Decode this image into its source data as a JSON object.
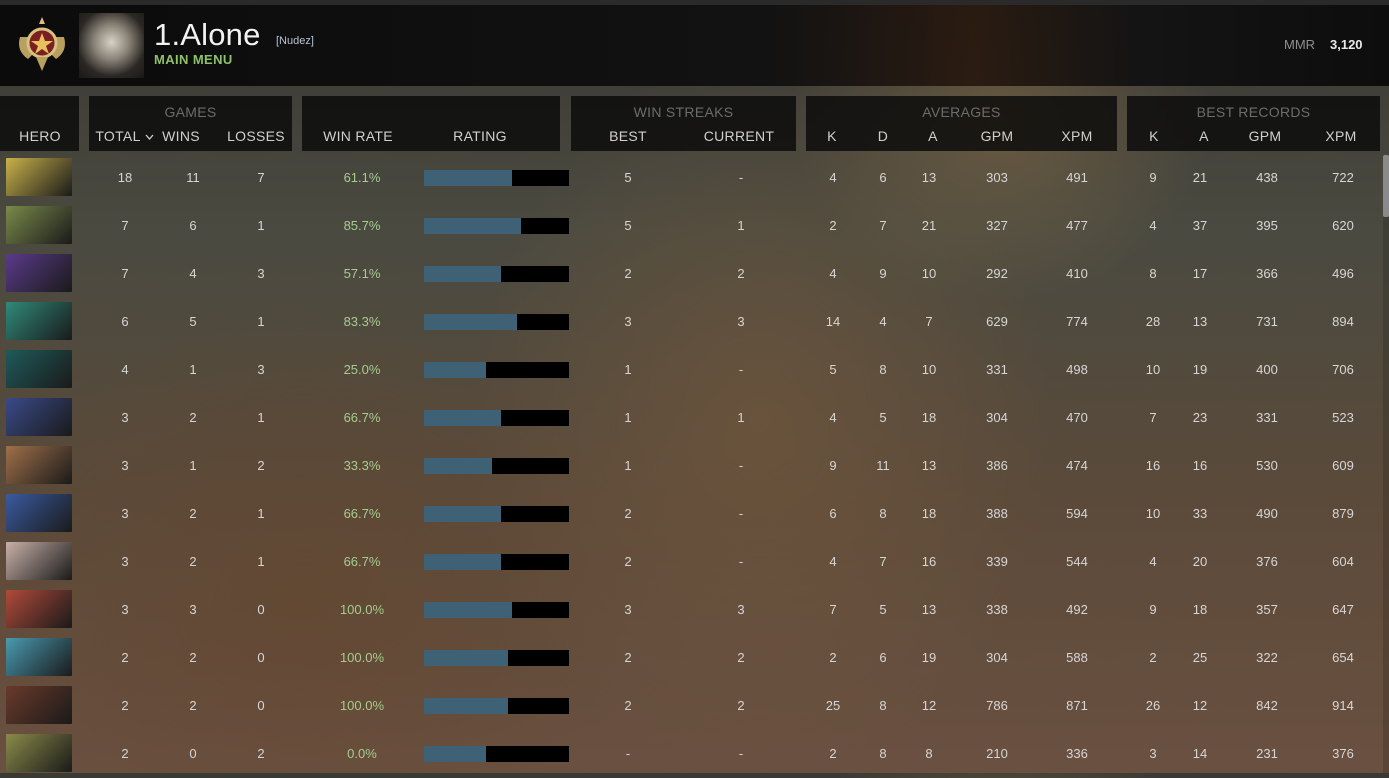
{
  "header": {
    "player_name": "1.Alone",
    "player_tag": "[Nudez]",
    "main_menu": "MAIN MENU",
    "mmr_label": "MMR",
    "mmr_value": "3,120"
  },
  "columns": {
    "hero": "HERO",
    "games_group": "GAMES",
    "total": "TOTAL",
    "wins": "WINS",
    "losses": "LOSSES",
    "win_rate": "WIN RATE",
    "rating": "RATING",
    "streaks_group": "WIN STREAKS",
    "best": "BEST",
    "current": "CURRENT",
    "averages_group": "AVERAGES",
    "best_records_group": "BEST RECORDS",
    "k": "K",
    "d": "D",
    "a": "A",
    "gpm": "GPM",
    "xpm": "XPM",
    "sort_indicator": "chevron-down-icon"
  },
  "colors": {
    "accent_green": "#8fc06a",
    "winrate_green": "#a5cc8f",
    "rating_bar": "#3f6175"
  },
  "rows": [
    {
      "hero_color": "#c9b24a",
      "total": "18",
      "wins": "11",
      "losses": "7",
      "winrate": "61.1%",
      "rating": 0.61,
      "best_streak": "5",
      "current_streak": "-",
      "avg_k": "4",
      "avg_d": "6",
      "avg_a": "13",
      "avg_gpm": "303",
      "avg_xpm": "491",
      "best_k": "9",
      "best_a": "21",
      "best_gpm": "438",
      "best_xpm": "722"
    },
    {
      "hero_color": "#7a8a4a",
      "total": "7",
      "wins": "6",
      "losses": "1",
      "winrate": "85.7%",
      "rating": 0.67,
      "best_streak": "5",
      "current_streak": "1",
      "avg_k": "2",
      "avg_d": "7",
      "avg_a": "21",
      "avg_gpm": "327",
      "avg_xpm": "477",
      "best_k": "4",
      "best_a": "37",
      "best_gpm": "395",
      "best_xpm": "620"
    },
    {
      "hero_color": "#5a3a8a",
      "total": "7",
      "wins": "4",
      "losses": "3",
      "winrate": "57.1%",
      "rating": 0.53,
      "best_streak": "2",
      "current_streak": "2",
      "avg_k": "4",
      "avg_d": "9",
      "avg_a": "10",
      "avg_gpm": "292",
      "avg_xpm": "410",
      "best_k": "8",
      "best_a": "17",
      "best_gpm": "366",
      "best_xpm": "496"
    },
    {
      "hero_color": "#2f8a7a",
      "total": "6",
      "wins": "5",
      "losses": "1",
      "winrate": "83.3%",
      "rating": 0.64,
      "best_streak": "3",
      "current_streak": "3",
      "avg_k": "14",
      "avg_d": "4",
      "avg_a": "7",
      "avg_gpm": "629",
      "avg_xpm": "774",
      "best_k": "28",
      "best_a": "13",
      "best_gpm": "731",
      "best_xpm": "894"
    },
    {
      "hero_color": "#1f5a5a",
      "total": "4",
      "wins": "1",
      "losses": "3",
      "winrate": "25.0%",
      "rating": 0.43,
      "best_streak": "1",
      "current_streak": "-",
      "avg_k": "5",
      "avg_d": "8",
      "avg_a": "10",
      "avg_gpm": "331",
      "avg_xpm": "498",
      "best_k": "10",
      "best_a": "19",
      "best_gpm": "400",
      "best_xpm": "706"
    },
    {
      "hero_color": "#3a4a8a",
      "total": "3",
      "wins": "2",
      "losses": "1",
      "winrate": "66.7%",
      "rating": 0.53,
      "best_streak": "1",
      "current_streak": "1",
      "avg_k": "4",
      "avg_d": "5",
      "avg_a": "18",
      "avg_gpm": "304",
      "avg_xpm": "470",
      "best_k": "7",
      "best_a": "23",
      "best_gpm": "331",
      "best_xpm": "523"
    },
    {
      "hero_color": "#a0704a",
      "total": "3",
      "wins": "1",
      "losses": "2",
      "winrate": "33.3%",
      "rating": 0.47,
      "best_streak": "1",
      "current_streak": "-",
      "avg_k": "9",
      "avg_d": "11",
      "avg_a": "13",
      "avg_gpm": "386",
      "avg_xpm": "474",
      "best_k": "16",
      "best_a": "16",
      "best_gpm": "530",
      "best_xpm": "609"
    },
    {
      "hero_color": "#3a5aa0",
      "total": "3",
      "wins": "2",
      "losses": "1",
      "winrate": "66.7%",
      "rating": 0.53,
      "best_streak": "2",
      "current_streak": "-",
      "avg_k": "6",
      "avg_d": "8",
      "avg_a": "18",
      "avg_gpm": "388",
      "avg_xpm": "594",
      "best_k": "10",
      "best_a": "33",
      "best_gpm": "490",
      "best_xpm": "879"
    },
    {
      "hero_color": "#c8b0a8",
      "total": "3",
      "wins": "2",
      "losses": "1",
      "winrate": "66.7%",
      "rating": 0.53,
      "best_streak": "2",
      "current_streak": "-",
      "avg_k": "4",
      "avg_d": "7",
      "avg_a": "16",
      "avg_gpm": "339",
      "avg_xpm": "544",
      "best_k": "4",
      "best_a": "20",
      "best_gpm": "376",
      "best_xpm": "604"
    },
    {
      "hero_color": "#b04a3a",
      "total": "3",
      "wins": "3",
      "losses": "0",
      "winrate": "100.0%",
      "rating": 0.61,
      "best_streak": "3",
      "current_streak": "3",
      "avg_k": "7",
      "avg_d": "5",
      "avg_a": "13",
      "avg_gpm": "338",
      "avg_xpm": "492",
      "best_k": "9",
      "best_a": "18",
      "best_gpm": "357",
      "best_xpm": "647"
    },
    {
      "hero_color": "#4a9ab0",
      "total": "2",
      "wins": "2",
      "losses": "0",
      "winrate": "100.0%",
      "rating": 0.58,
      "best_streak": "2",
      "current_streak": "2",
      "avg_k": "2",
      "avg_d": "6",
      "avg_a": "19",
      "avg_gpm": "304",
      "avg_xpm": "588",
      "best_k": "2",
      "best_a": "25",
      "best_gpm": "322",
      "best_xpm": "654"
    },
    {
      "hero_color": "#6a3a2a",
      "total": "2",
      "wins": "2",
      "losses": "0",
      "winrate": "100.0%",
      "rating": 0.58,
      "best_streak": "2",
      "current_streak": "2",
      "avg_k": "25",
      "avg_d": "8",
      "avg_a": "12",
      "avg_gpm": "786",
      "avg_xpm": "871",
      "best_k": "26",
      "best_a": "12",
      "best_gpm": "842",
      "best_xpm": "914"
    },
    {
      "hero_color": "#8a8a4a",
      "total": "2",
      "wins": "0",
      "losses": "2",
      "winrate": "0.0%",
      "rating": 0.43,
      "best_streak": "-",
      "current_streak": "-",
      "avg_k": "2",
      "avg_d": "8",
      "avg_a": "8",
      "avg_gpm": "210",
      "avg_xpm": "336",
      "best_k": "3",
      "best_a": "14",
      "best_gpm": "231",
      "best_xpm": "376"
    }
  ]
}
